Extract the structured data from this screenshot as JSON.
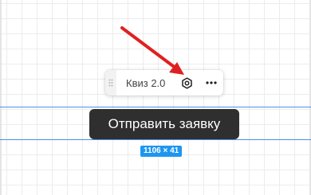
{
  "block_toolbar": {
    "label": "Квиз 2.0",
    "drag_icon": "drag-dots-icon",
    "settings_icon": "gear-icon",
    "more_icon": "more-horizontal-icon"
  },
  "form_button": {
    "label": "Отправить заявку"
  },
  "size_badge": {
    "text": "1106 × 41"
  },
  "annotation": {
    "arrow_color": "#e02020"
  },
  "colors": {
    "guide": "#4a8ef2",
    "badge": "#1e96f0",
    "button_bg": "#2f2f2f"
  }
}
